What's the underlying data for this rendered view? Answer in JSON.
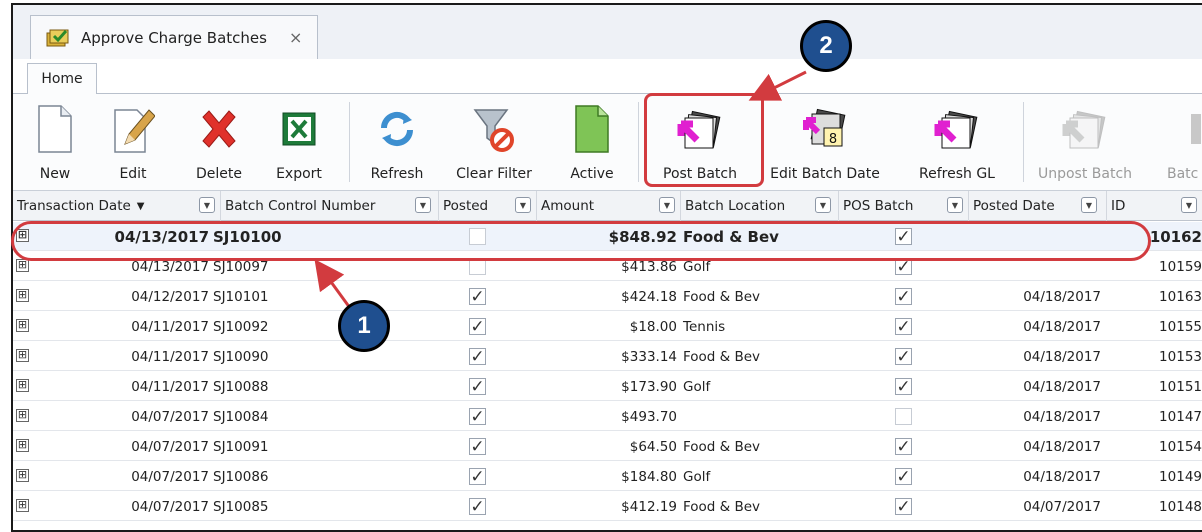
{
  "window": {
    "tab_title": "Approve Charge Batches",
    "tab_close": "×",
    "ribbon_tab": "Home"
  },
  "ribbon": {
    "new": "New",
    "edit": "Edit",
    "delete": "Delete",
    "export": "Export",
    "refresh": "Refresh",
    "clear_filter": "Clear Filter",
    "active": "Active",
    "post_batch": "Post Batch",
    "edit_batch_date": "Edit Batch Date",
    "refresh_gl": "Refresh GL",
    "unpost_batch": "Unpost Batch",
    "batch_partial": "Batc"
  },
  "columns": {
    "transaction_date": "Transaction Date",
    "sort_indicator": "▼",
    "batch_control_number": "Batch Control Number",
    "posted": "Posted",
    "amount": "Amount",
    "batch_location": "Batch Location",
    "pos_batch": "POS Batch",
    "posted_date": "Posted Date",
    "id": "ID"
  },
  "rows": [
    {
      "date": "04/13/2017",
      "batch": "SJ10100",
      "posted": false,
      "amount": "$848.92",
      "location": "Food & Bev",
      "pos": true,
      "posted_date": "",
      "id": "10162"
    },
    {
      "date": "04/13/2017",
      "batch": "SJ10097",
      "posted": false,
      "amount": "$413.86",
      "location": "Golf",
      "pos": true,
      "posted_date": "",
      "id": "10159"
    },
    {
      "date": "04/12/2017",
      "batch": "SJ10101",
      "posted": true,
      "amount": "$424.18",
      "location": "Food & Bev",
      "pos": true,
      "posted_date": "04/18/2017",
      "id": "10163"
    },
    {
      "date": "04/11/2017",
      "batch": "SJ10092",
      "posted": true,
      "amount": "$18.00",
      "location": "Tennis",
      "pos": true,
      "posted_date": "04/18/2017",
      "id": "10155"
    },
    {
      "date": "04/11/2017",
      "batch": "SJ10090",
      "posted": true,
      "amount": "$333.14",
      "location": "Food & Bev",
      "pos": true,
      "posted_date": "04/18/2017",
      "id": "10153"
    },
    {
      "date": "04/11/2017",
      "batch": "SJ10088",
      "posted": true,
      "amount": "$173.90",
      "location": "Golf",
      "pos": true,
      "posted_date": "04/18/2017",
      "id": "10151"
    },
    {
      "date": "04/07/2017",
      "batch": "SJ10084",
      "posted": true,
      "amount": "$493.70",
      "location": "",
      "pos": false,
      "posted_date": "04/18/2017",
      "id": "10147"
    },
    {
      "date": "04/07/2017",
      "batch": "SJ10091",
      "posted": true,
      "amount": "$64.50",
      "location": "Food & Bev",
      "pos": true,
      "posted_date": "04/18/2017",
      "id": "10154"
    },
    {
      "date": "04/07/2017",
      "batch": "SJ10086",
      "posted": true,
      "amount": "$184.80",
      "location": "Golf",
      "pos": true,
      "posted_date": "04/18/2017",
      "id": "10149"
    },
    {
      "date": "04/07/2017",
      "batch": "SJ10085",
      "posted": true,
      "amount": "$412.19",
      "location": "Food & Bev",
      "pos": true,
      "posted_date": "04/07/2017",
      "id": "10148"
    }
  ],
  "annotations": {
    "callout_1": "1",
    "callout_2": "2"
  },
  "colors": {
    "annotation_red": "#d23b3f",
    "badge_blue": "#1f4f8f",
    "post_icon_magenta": "#e020d0"
  },
  "icons": {
    "tab": "approve-batch-icon",
    "expand": "⊞",
    "check": "✓"
  }
}
